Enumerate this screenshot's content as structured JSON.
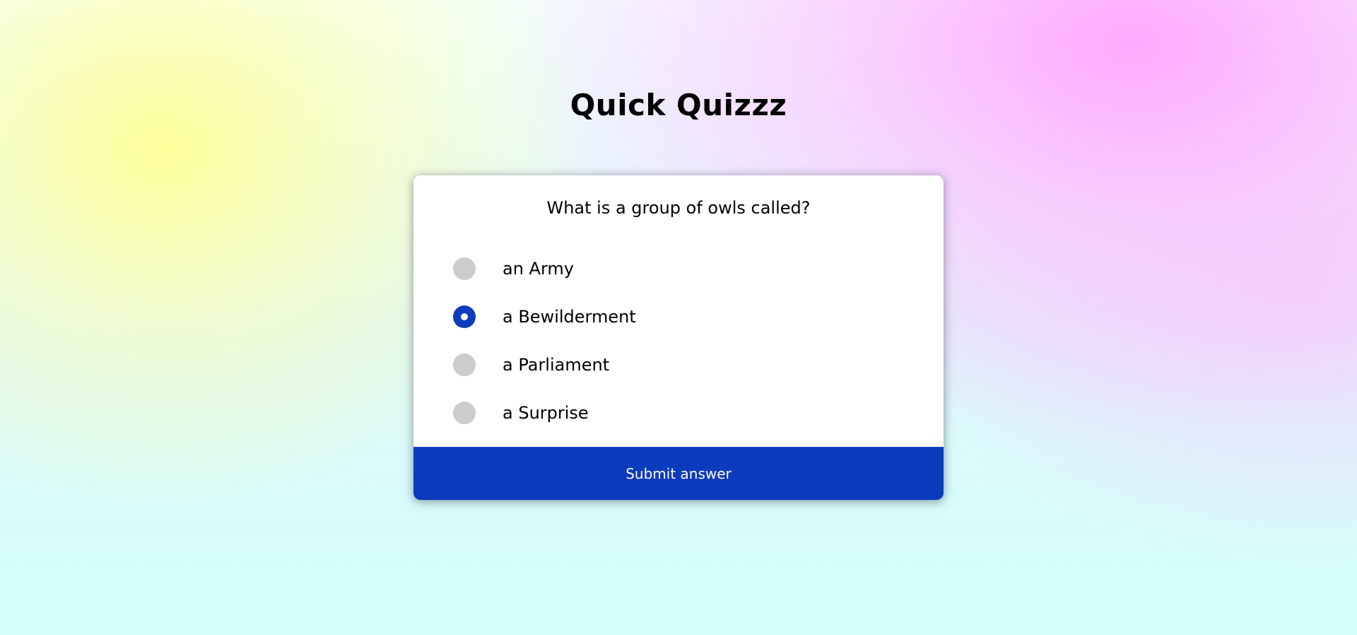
{
  "app": {
    "title": "Quick Quizzz"
  },
  "quiz": {
    "question": "What is a group of owls called?",
    "options": [
      {
        "label": "an Army",
        "selected": false
      },
      {
        "label": "a Bewilderment",
        "selected": true
      },
      {
        "label": "a Parliament",
        "selected": false
      },
      {
        "label": "a Surprise",
        "selected": false
      }
    ],
    "submit_label": "Submit answer"
  },
  "colors": {
    "accent": "#0c3bbd",
    "radio_unselected": "#cccccc",
    "card_background": "#ffffff"
  }
}
